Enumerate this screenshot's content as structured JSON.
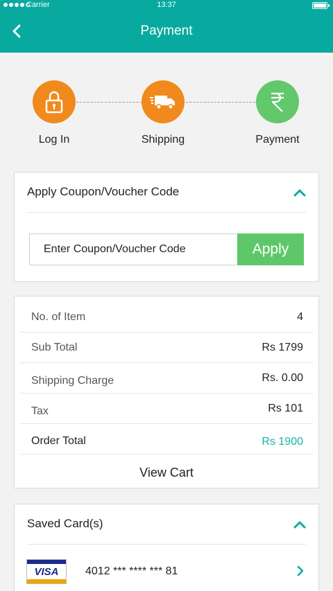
{
  "status_bar": {
    "carrier": "Carrier",
    "time": "13:37"
  },
  "header": {
    "title": "Payment"
  },
  "steps": [
    {
      "label": "Log In",
      "icon": "lock-icon",
      "color": "#f08a1c"
    },
    {
      "label": "Shipping",
      "icon": "truck-icon",
      "color": "#f08a1c"
    },
    {
      "label": "Payment",
      "icon": "rupee-icon",
      "color": "#62c86b"
    }
  ],
  "coupon": {
    "title": "Apply Coupon/Voucher Code",
    "placeholder": "Enter Coupon/Voucher Code",
    "apply_label": "Apply"
  },
  "summary": {
    "rows": [
      {
        "label": "No. of Item",
        "value": "4"
      },
      {
        "label": "Sub Total",
        "value": "Rs 1799"
      },
      {
        "label": "Shipping Charge",
        "value": "Rs. 0.00"
      },
      {
        "label": "Tax",
        "value": "Rs 101"
      },
      {
        "label": "Order Total",
        "value": "Rs 1900"
      }
    ],
    "view_cart_label": "View Cart"
  },
  "saved_cards": {
    "title": "Saved Card(s)",
    "cards": [
      {
        "brand": "VISA",
        "number": "4012 *** **** *** 81"
      }
    ]
  },
  "colors": {
    "accent": "#08aaa0",
    "apply": "#5dc76a",
    "total": "#14b3a8",
    "orange": "#f08a1c"
  }
}
